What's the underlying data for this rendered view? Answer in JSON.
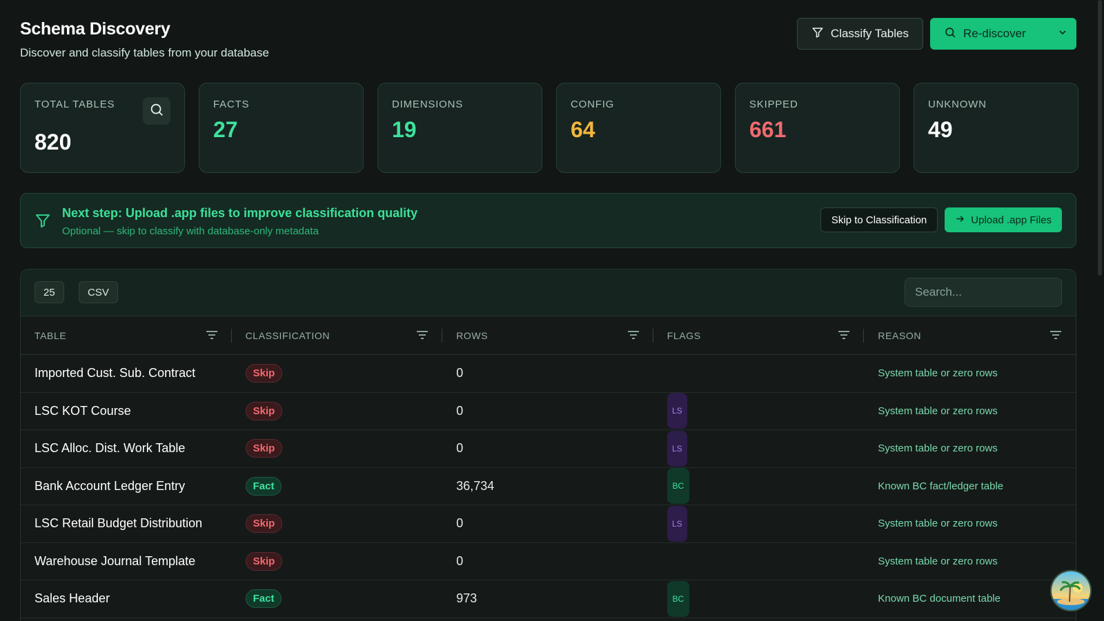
{
  "header": {
    "title": "Schema Discovery",
    "subtitle": "Discover and classify tables from your database",
    "classify_label": "Classify Tables",
    "rediscover_label": "Re-discover"
  },
  "stats": [
    {
      "label": "TOTAL TABLES",
      "value": "820",
      "color": "#ffffff"
    },
    {
      "label": "FACTS",
      "value": "27",
      "color": "#3ee29d"
    },
    {
      "label": "DIMENSIONS",
      "value": "19",
      "color": "#3ee29d"
    },
    {
      "label": "CONFIG",
      "value": "64",
      "color": "#f3b63b"
    },
    {
      "label": "SKIPPED",
      "value": "661",
      "color": "#f06a70"
    },
    {
      "label": "UNKNOWN",
      "value": "49",
      "color": "#ffffff"
    }
  ],
  "banner": {
    "title": "Next step: Upload .app files to improve classification quality",
    "subtitle": "Optional — skip to classify with database-only metadata",
    "skip_label": "Skip to Classification",
    "upload_label": "Upload .app Files"
  },
  "toolbar": {
    "page_size": "25",
    "csv_label": "CSV",
    "search_placeholder": "Search..."
  },
  "table": {
    "columns": [
      "TABLE",
      "CLASSIFICATION",
      "ROWS",
      "FLAGS",
      "REASON"
    ],
    "rows": [
      {
        "table": "Imported Cust. Sub. Contract",
        "classification": "Skip",
        "rows": "0",
        "flag": "",
        "reason": "System table or zero rows"
      },
      {
        "table": "LSC KOT Course",
        "classification": "Skip",
        "rows": "0",
        "flag": "LS",
        "reason": "System table or zero rows"
      },
      {
        "table": "LSC Alloc. Dist. Work Table",
        "classification": "Skip",
        "rows": "0",
        "flag": "LS",
        "reason": "System table or zero rows"
      },
      {
        "table": "Bank Account Ledger Entry",
        "classification": "Fact",
        "rows": "36,734",
        "flag": "BC",
        "reason": "Known BC fact/ledger table"
      },
      {
        "table": "LSC Retail Budget Distribution",
        "classification": "Skip",
        "rows": "0",
        "flag": "LS",
        "reason": "System table or zero rows"
      },
      {
        "table": "Warehouse Journal Template",
        "classification": "Skip",
        "rows": "0",
        "flag": "",
        "reason": "System table or zero rows"
      },
      {
        "table": "Sales Header",
        "classification": "Fact",
        "rows": "973",
        "flag": "BC",
        "reason": "Known BC document table"
      }
    ]
  },
  "colors": {
    "accent": "#17c27a",
    "skip": "#f06a70",
    "fact": "#3ee29d",
    "config": "#f3b63b",
    "flag_ls": "#a77ef0"
  }
}
